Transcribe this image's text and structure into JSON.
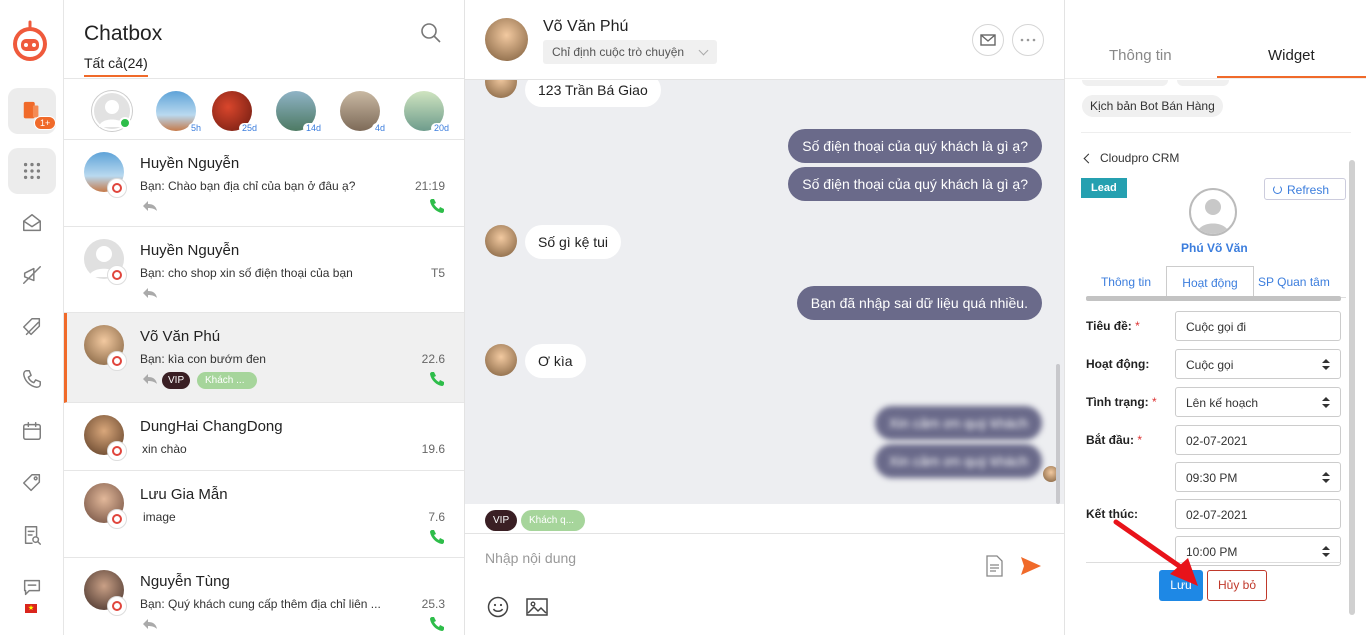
{
  "list": {
    "title": "Chatbox",
    "tab_all": "Tất cả(24)",
    "stories": [
      {
        "badge": ""
      },
      {
        "badge": "5h"
      },
      {
        "badge": "25d"
      },
      {
        "badge": "14d"
      },
      {
        "badge": "4d"
      },
      {
        "badge": "20d"
      }
    ],
    "conversations": [
      {
        "name": "Huyền Nguyễn",
        "message": "Bạn: Chào bạn địa chỉ của bạn ở đâu ạ?",
        "time": "21:19"
      },
      {
        "name": "Huyền Nguyễn",
        "message": "Bạn: cho shop xin số điện thoại của bạn",
        "time": "T5"
      },
      {
        "name": "Võ Văn Phú",
        "message": "Bạn: kìa con bướm đen",
        "time": "22.6",
        "tags": [
          "VIP",
          "Khách ..."
        ]
      },
      {
        "name": "DungHai ChangDong",
        "message": "xin chào",
        "time": "19.6"
      },
      {
        "name": "Lưu Gia Mẫn",
        "message": "image",
        "time": "7.6"
      },
      {
        "name": "Nguyễn Tùng",
        "message": "Bạn: Quý khách cung cấp thêm địa chỉ liên ...",
        "time": "25.3"
      }
    ]
  },
  "nav": {
    "badge": "1+",
    "flag": "★"
  },
  "chat": {
    "name": "Võ Văn Phú",
    "assign_placeholder": "Chỉ định cuộc trò chuyện",
    "messages": {
      "m1": "123 Trần Bá Giao",
      "m2": "Số điện thoại của quý khách là gì ạ?",
      "m3": "Số điện thoại của quý khách là gì ạ?",
      "m4": "Số gì kệ tui",
      "m5": "Bạn đã nhập sai dữ liệu quá nhiều.",
      "m6": "Ơ kìa",
      "m7": "Xin cảm ơn quý khách",
      "m8": "Xin cảm ơn quý khách"
    },
    "tags": [
      "VIP",
      "Khách q..."
    ],
    "input_placeholder": "Nhập nội dung"
  },
  "side": {
    "tab_info": "Thông tin",
    "tab_widget": "Widget",
    "chip": "Kịch bản Bot Bán Hàng",
    "crm_back": "Cloudpro CRM",
    "lead": "Lead",
    "refresh": "Refresh",
    "contact_name": "Phú Võ Văn",
    "crm_tabs": [
      "Thông tin",
      "Hoạt động",
      "SP Quan tâm"
    ],
    "form": {
      "title_label": "Tiêu đề:",
      "title_value": "Cuộc gọi đi",
      "activity_label": "Hoạt động:",
      "activity_value": "Cuộc gọi",
      "status_label": "Tình trạng:",
      "status_value": "Lên kế hoạch",
      "start_label": "Bắt đầu:",
      "start_date": "02-07-2021",
      "start_time": "09:30 PM",
      "end_label": "Kết thúc:",
      "end_date": "02-07-2021",
      "end_time": "10:00 PM",
      "required": "*"
    },
    "save": "Lưu",
    "cancel": "Hủy bỏ"
  },
  "colors": {
    "accent": "#f06a2a",
    "bubble_out": "#6a6a8a",
    "link": "#3b7ddd",
    "call": "#2ebd4a"
  }
}
